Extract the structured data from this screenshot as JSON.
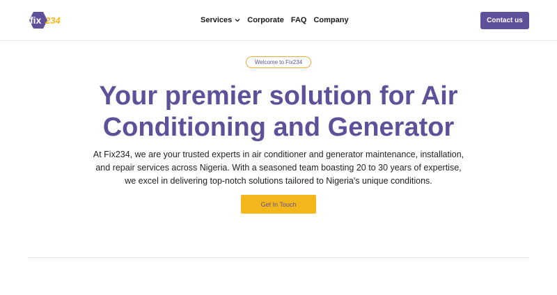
{
  "brand": {
    "logo_text_main": "fix",
    "logo_text_num": "234",
    "primary_color": "#5e5199",
    "accent_color": "#f4b71b"
  },
  "nav": {
    "items": [
      {
        "label": "Services",
        "has_dropdown": true
      },
      {
        "label": "Corporate",
        "has_dropdown": false
      },
      {
        "label": "FAQ",
        "has_dropdown": false
      },
      {
        "label": "Company",
        "has_dropdown": false
      }
    ]
  },
  "header": {
    "contact_label": "Contact us"
  },
  "hero": {
    "badge": "Welcome to Fix234",
    "headline_line1": "Your premier solution for Air",
    "headline_line2": "Conditioning and Generator",
    "description_line1": "At Fix234, we are your trusted experts in air conditioner and generator maintenance, installation,",
    "description_line2": "and repair services across Nigeria. With a seasoned team boasting 20 to 30 years of expertise,",
    "description_line3": "we excel in delivering top-notch solutions tailored to Nigeria's unique conditions.",
    "cta_label": "Get In Touch"
  }
}
